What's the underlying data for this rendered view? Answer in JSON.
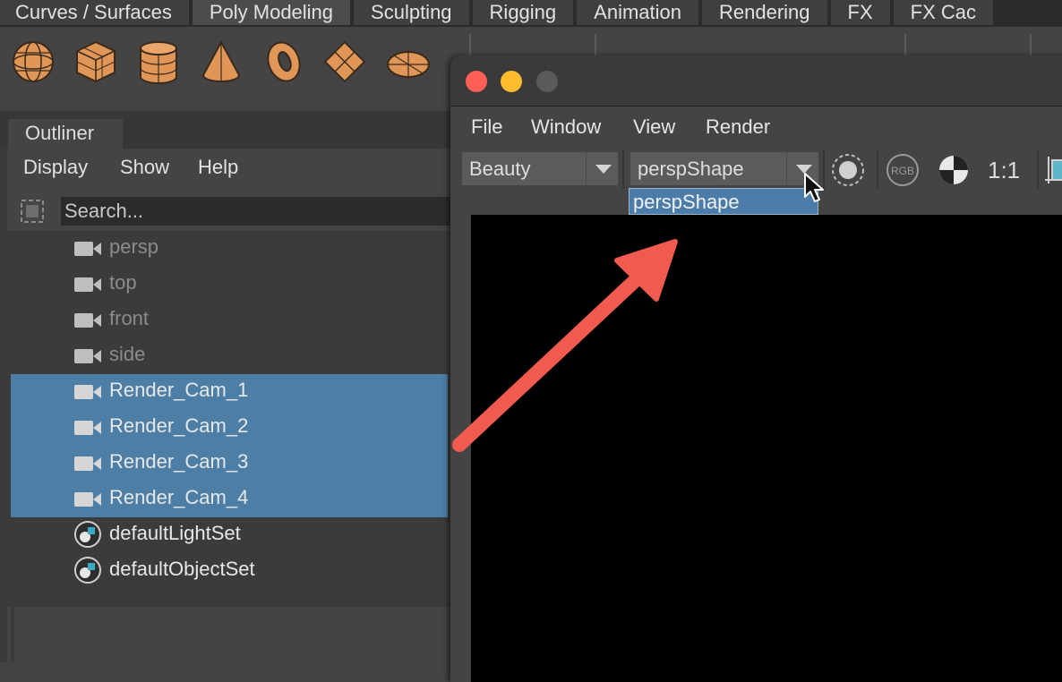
{
  "shelf_tabs": [
    {
      "label": "Curves / Surfaces",
      "active": false
    },
    {
      "label": "Poly Modeling",
      "active": true
    },
    {
      "label": "Sculpting",
      "active": false
    },
    {
      "label": "Rigging",
      "active": false
    },
    {
      "label": "Animation",
      "active": false
    },
    {
      "label": "Rendering",
      "active": false
    },
    {
      "label": "FX",
      "active": false
    },
    {
      "label": "FX Cac",
      "active": false
    }
  ],
  "shelf_icons": [
    "poly-sphere-icon",
    "poly-cube-icon",
    "poly-cylinder-icon",
    "poly-cone-icon",
    "poly-torus-icon",
    "poly-plane-icon",
    "poly-disc-icon"
  ],
  "shelf_icon_color": "#e09656",
  "outliner": {
    "tab_label": "Outliner",
    "menu": {
      "display": "Display",
      "show": "Show",
      "help": "Help"
    },
    "search_placeholder": "Search...",
    "items": [
      {
        "label": "persp",
        "icon": "camera-icon",
        "selected": false,
        "dim": true
      },
      {
        "label": "top",
        "icon": "camera-icon",
        "selected": false,
        "dim": true
      },
      {
        "label": "front",
        "icon": "camera-icon",
        "selected": false,
        "dim": true
      },
      {
        "label": "side",
        "icon": "camera-icon",
        "selected": false,
        "dim": true
      },
      {
        "label": "Render_Cam_1",
        "icon": "camera-icon",
        "selected": true,
        "dim": false
      },
      {
        "label": "Render_Cam_2",
        "icon": "camera-icon",
        "selected": true,
        "dim": false
      },
      {
        "label": "Render_Cam_3",
        "icon": "camera-icon",
        "selected": true,
        "dim": false
      },
      {
        "label": "Render_Cam_4",
        "icon": "camera-icon",
        "selected": true,
        "dim": false
      },
      {
        "label": "defaultLightSet",
        "icon": "set-icon",
        "selected": false,
        "dim": false
      },
      {
        "label": "defaultObjectSet",
        "icon": "set-icon",
        "selected": false,
        "dim": false
      }
    ],
    "selection_color": "#4d7ea6"
  },
  "render_window": {
    "menu": {
      "file": "File",
      "window": "Window",
      "view": "View",
      "render": "Render"
    },
    "pass_combo": "Beauty",
    "camera_combo": "perspShape",
    "dropdown_items": [
      "perspShape"
    ],
    "toolbar": {
      "rgb_label": "RGB",
      "ratio_label": "1:1"
    },
    "traffic_colors": {
      "close": "#ff5f57",
      "minimize": "#febc2e",
      "zoom": "#5a5a5a"
    }
  },
  "annotation": {
    "arrow_color": "#f05a4f"
  }
}
